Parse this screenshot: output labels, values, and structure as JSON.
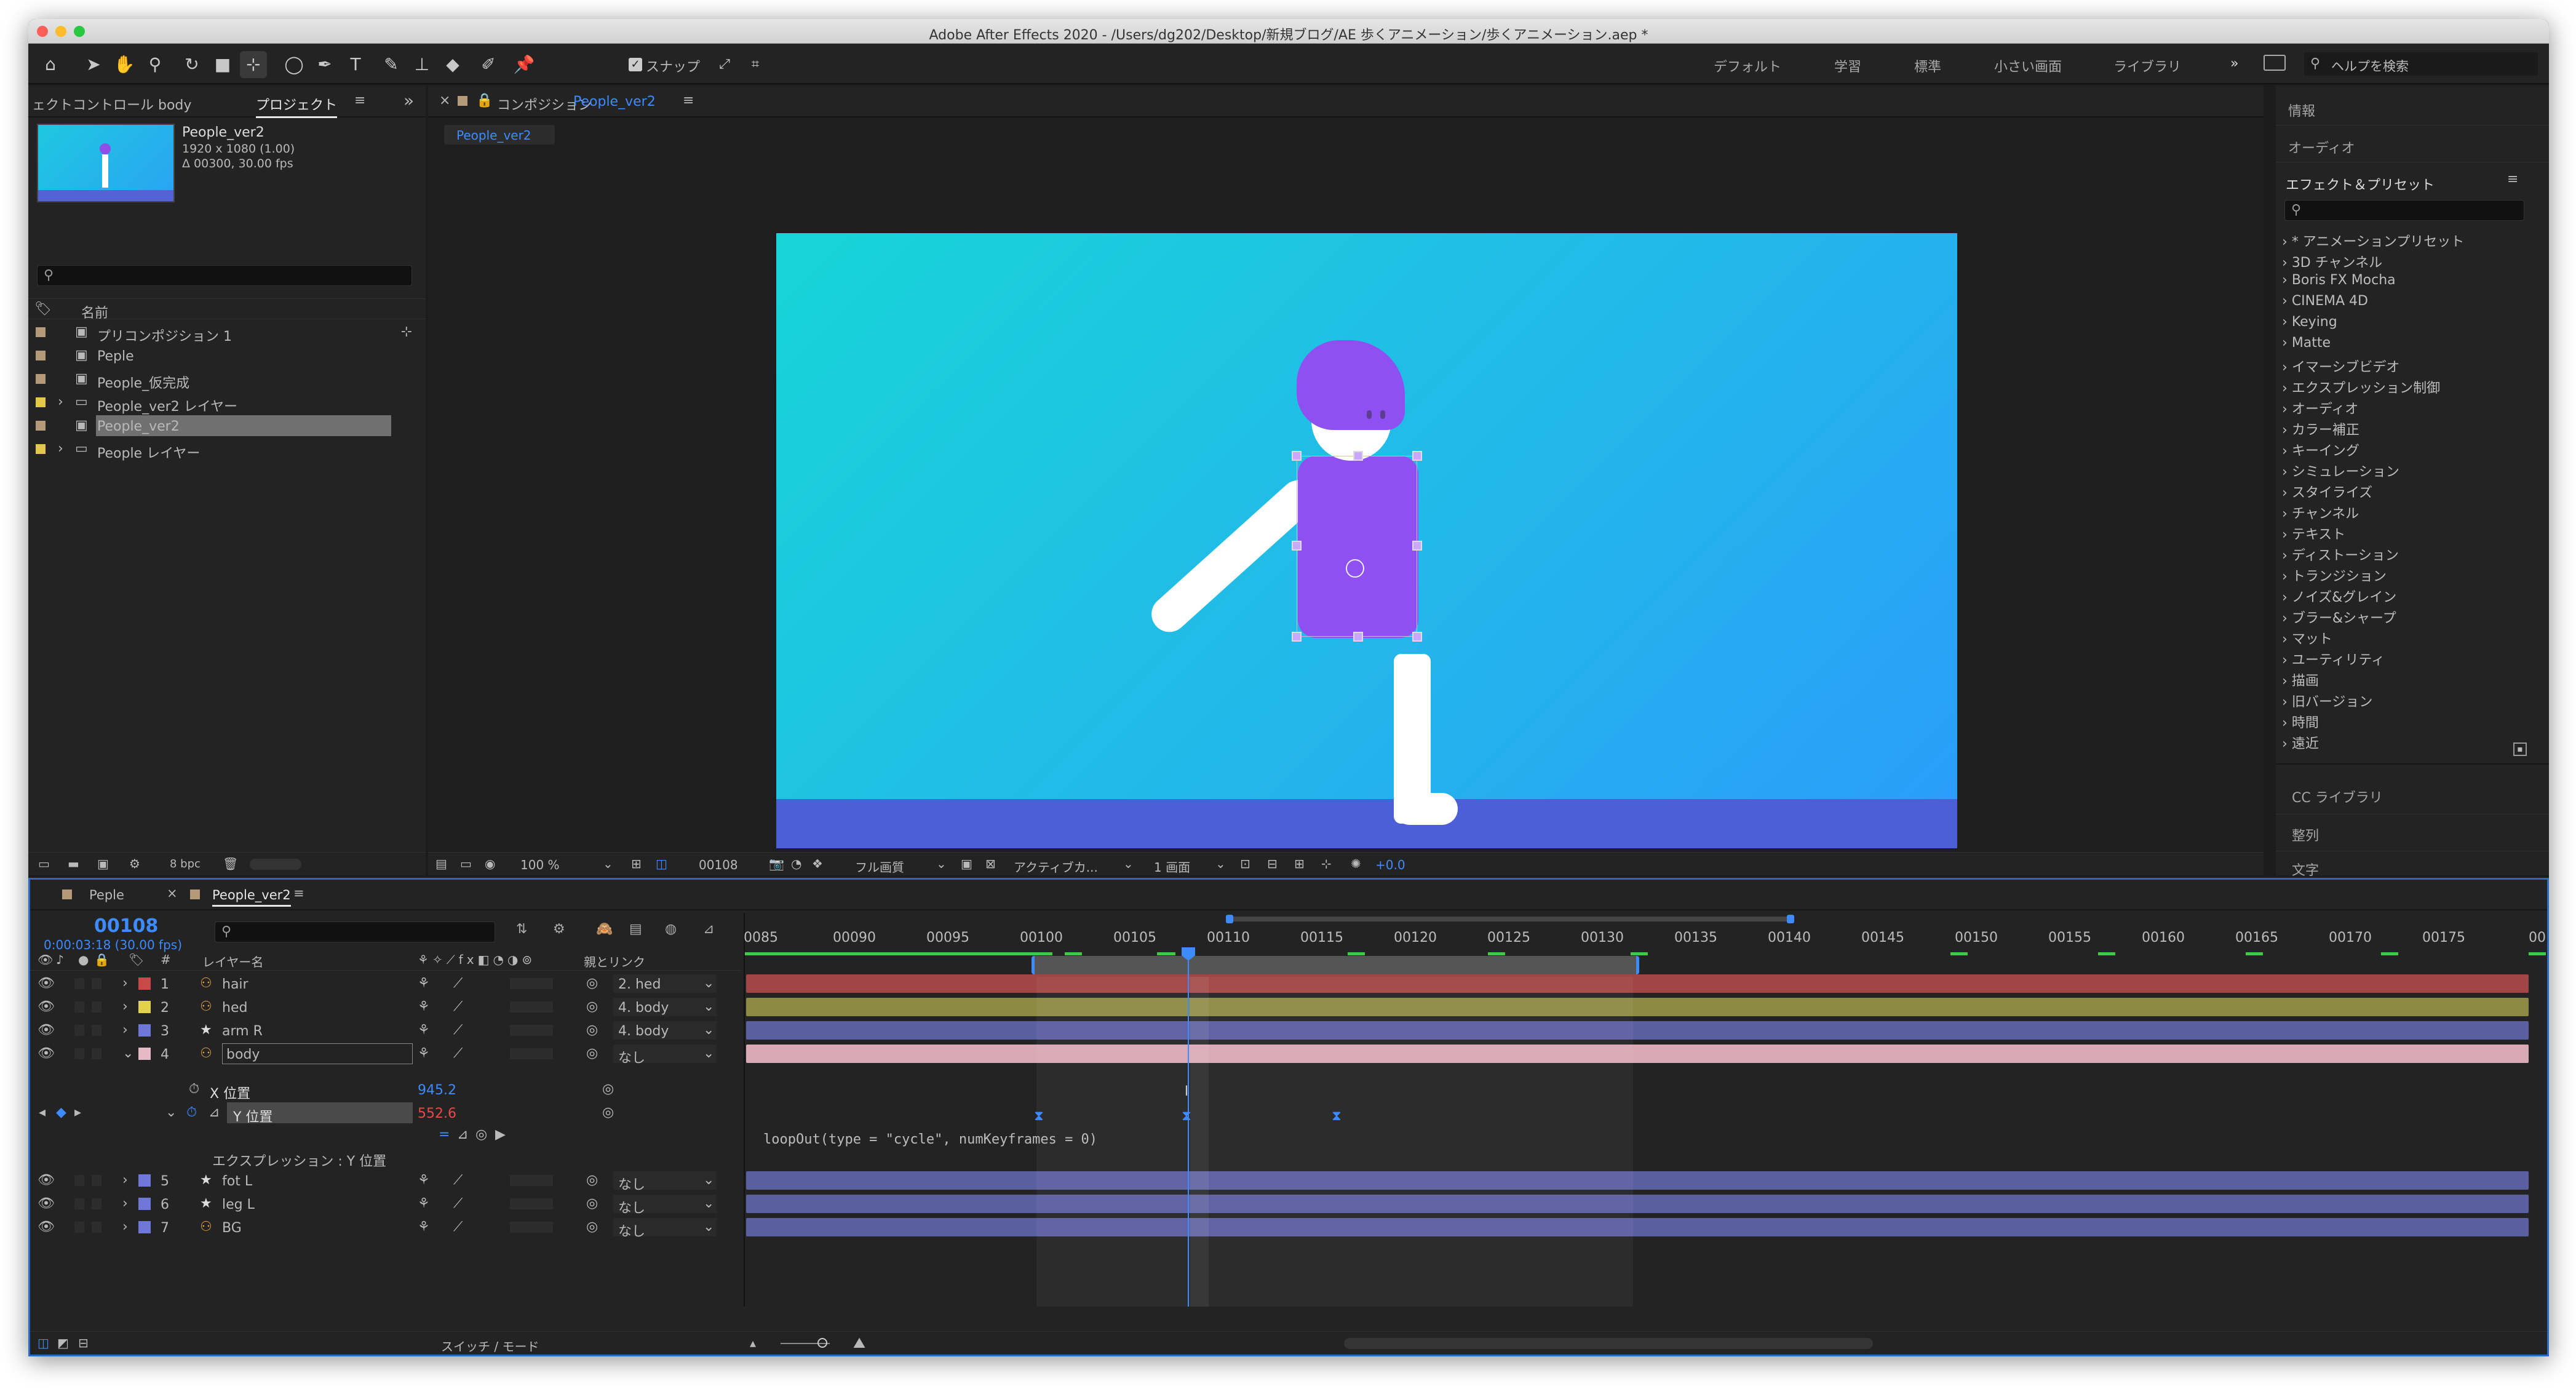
{
  "window": {
    "title": "Adobe After Effects 2020 - /Users/dg202/Desktop/新規ブログ/AE 歩くアニメーション/歩くアニメーション.aep *"
  },
  "toolbar": {
    "snap_label": "スナップ",
    "workspaces": [
      "デフォルト",
      "学習",
      "標準",
      "小さい画面",
      "ライブラリ"
    ],
    "help_placeholder": "ヘルプを検索"
  },
  "project_panel": {
    "tabs": [
      "ェクトコントロール body",
      "プロジェクト"
    ],
    "item_name": "People_ver2",
    "item_dims": "1920 x 1080 (1.00)",
    "item_dur": "Δ 00300, 30.00 fps",
    "column_name": "名前",
    "items": [
      {
        "name": "プリコンポジション 1",
        "type": "comp",
        "color": "#b59a7a"
      },
      {
        "name": "Peple",
        "type": "comp",
        "color": "#b59a7a"
      },
      {
        "name": "People_仮完成",
        "type": "comp",
        "color": "#b59a7a"
      },
      {
        "name": "People_ver2 レイヤー",
        "type": "folder",
        "color": "#e3c84b"
      },
      {
        "name": "People_ver2",
        "type": "comp",
        "color": "#b59a7a",
        "selected": true
      },
      {
        "name": "People レイヤー",
        "type": "folder",
        "color": "#e3c84b"
      }
    ],
    "bpc": "8 bpc"
  },
  "comp_panel": {
    "header_label": "コンポジション",
    "header_comp": "People_ver2",
    "tab": "People_ver2",
    "zoom": "100 %",
    "frame": "00108",
    "quality": "フル画質",
    "camera": "アクティブカ...",
    "views": "1 画面",
    "exposure": "+0.0"
  },
  "right_panel": {
    "info": "情報",
    "audio": "オーディオ",
    "effects_title": "エフェクト＆プリセット",
    "effects": [
      "* アニメーションプリセット",
      "3D チャンネル",
      "Boris FX Mocha",
      "CINEMA 4D",
      "Keying",
      "Matte",
      "イマーシブビデオ",
      "エクスプレッション制御",
      "オーディオ",
      "カラー補正",
      "キーイング",
      "シミュレーション",
      "スタイライズ",
      "チャンネル",
      "テキスト",
      "ディストーション",
      "トランジション",
      "ノイズ&グレイン",
      "ブラー&シャープ",
      "マット",
      "ユーティリティ",
      "描画",
      "旧バージョン",
      "時間",
      "遠近"
    ],
    "cc_libraries": "CC ライブラリ",
    "align": "整列",
    "text": "文字"
  },
  "timeline": {
    "tabs": [
      "Peple",
      "People_ver2"
    ],
    "timecode": "00108",
    "timecode_sub": "0:00:03:18 (30.00 fps)",
    "col_layer_name": "レイヤー名",
    "col_parent": "親とリンク",
    "layers": [
      {
        "num": "1",
        "name": "hair",
        "color": "#c94848",
        "icon": "puppet",
        "parent": "2. hed",
        "bar": "#a14646"
      },
      {
        "num": "2",
        "name": "hed",
        "color": "#e3d34b",
        "icon": "puppet",
        "parent": "4. body",
        "bar": "#8d8a44"
      },
      {
        "num": "3",
        "name": "arm R",
        "color": "#6f78d9",
        "icon": "star",
        "parent": "4. body",
        "bar": "#5a5fa0"
      },
      {
        "num": "4",
        "name": "body",
        "color": "#e6b9c6",
        "icon": "puppet",
        "parent": "なし",
        "bar": "#d9a9b6"
      }
    ],
    "x_position_label": "X 位置",
    "x_position_value": "945.2",
    "y_position_label": "Y 位置",
    "y_position_value": "552.6",
    "expression_label": "エクスプレッション : Y 位置",
    "expression_code": "loopOut(type = \"cycle\", numKeyframes = 0)",
    "layers_bottom": [
      {
        "num": "5",
        "name": "fot L",
        "color": "#6f78d9",
        "icon": "star",
        "parent": "なし",
        "bar": "#5a5fa0"
      },
      {
        "num": "6",
        "name": "leg L",
        "color": "#6f78d9",
        "icon": "star",
        "parent": "なし",
        "bar": "#5a5fa0"
      },
      {
        "num": "7",
        "name": "BG",
        "color": "#6f78d9",
        "icon": "puppet",
        "parent": "なし",
        "bar": "#5a5fa0"
      }
    ],
    "ruler": [
      "0085",
      "00090",
      "00095",
      "00100",
      "00105",
      "00110",
      "00115",
      "00120",
      "00125",
      "00130",
      "00135",
      "00140",
      "00145",
      "00150",
      "00155",
      "00160",
      "00165",
      "00170",
      "00175",
      "00"
    ],
    "switch_mode": "スイッチ / モード"
  }
}
